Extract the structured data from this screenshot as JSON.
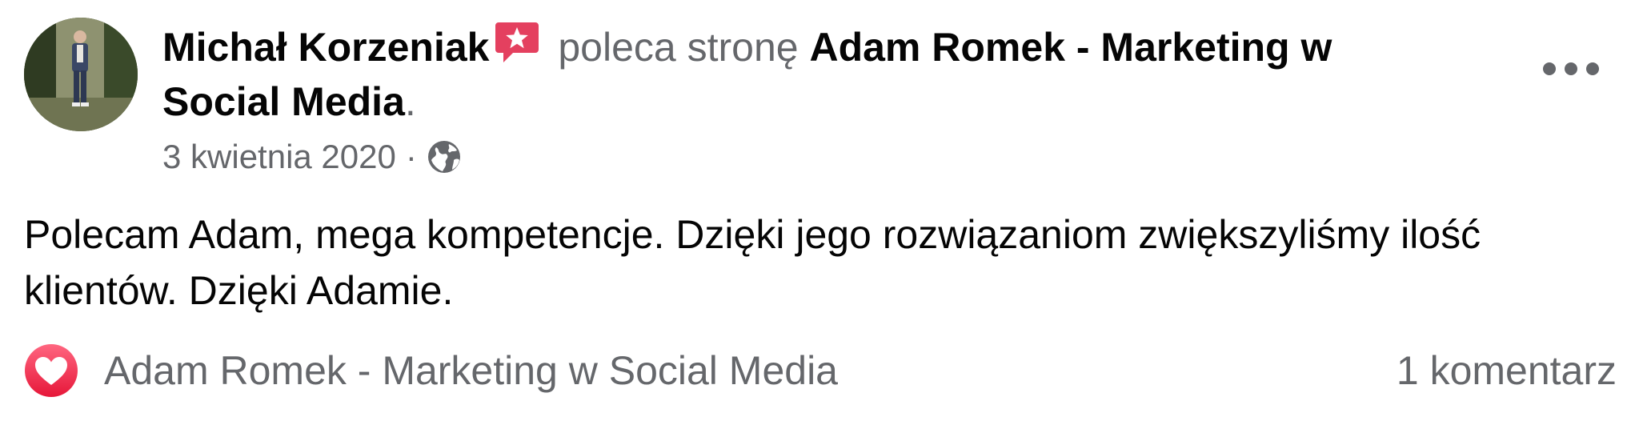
{
  "post": {
    "author": "Michał Korzeniak",
    "recommends_text": "poleca stronę",
    "page_name": "Adam Romek - Marketing w Social Media",
    "period": ".",
    "date": "3 kwietnia 2020",
    "separator": "·",
    "audience_icon": "globe-icon",
    "recommendation_icon": "recommendation-star-icon",
    "body": "Polecam Adam, mega kompetencje. Dzięki jego rozwiązaniom zwiększyliśmy ilość klientów. Dzięki Adamie."
  },
  "footer": {
    "reaction_icon": "love-reaction-icon",
    "reaction_names": "Adam Romek - Marketing w Social Media",
    "comments": "1 komentarz"
  },
  "menu": {
    "icon": "more-options-icon"
  },
  "colors": {
    "text": "#050505",
    "secondary_text": "#65676b",
    "recommend_red": "#e4405f",
    "love_red": "#f33e58"
  }
}
